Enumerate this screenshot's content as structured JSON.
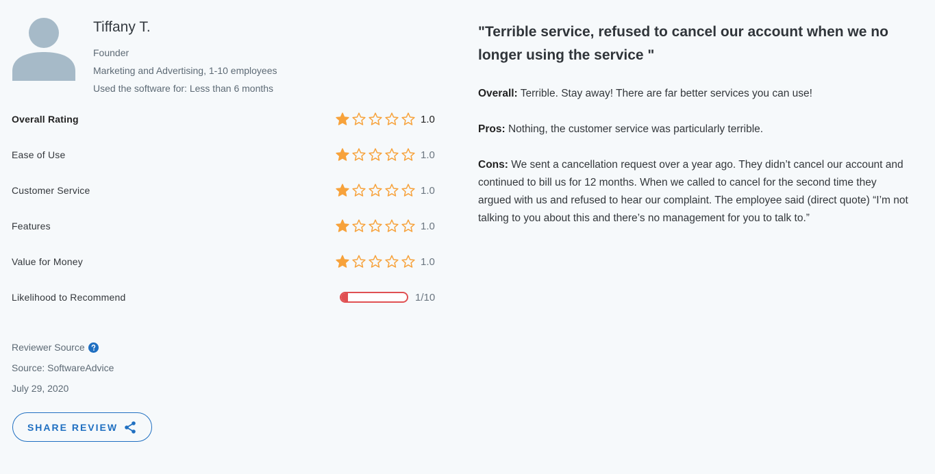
{
  "reviewer": {
    "name": "Tiffany T.",
    "role": "Founder",
    "company": "Marketing and Advertising, 1-10 employees",
    "usage": "Used the software for: Less than 6 months"
  },
  "ratings": [
    {
      "label": "Overall Rating",
      "value": "1.0",
      "stars": 1
    },
    {
      "label": "Ease of Use",
      "value": "1.0",
      "stars": 1
    },
    {
      "label": "Customer Service",
      "value": "1.0",
      "stars": 1
    },
    {
      "label": "Features",
      "value": "1.0",
      "stars": 1
    },
    {
      "label": "Value for Money",
      "value": "1.0",
      "stars": 1
    }
  ],
  "recommend": {
    "label": "Likelihood to Recommend",
    "value": "1/10",
    "fraction": 0.1
  },
  "source": {
    "reviewer_source_label": "Reviewer Source",
    "source_text": "Source: SoftwareAdvice",
    "date": "July 29, 2020"
  },
  "share_button": "SHARE REVIEW",
  "review": {
    "title": "\"Terrible service, refused to cancel our account when we no longer using the service \"",
    "overall_label": "Overall:",
    "overall_text": "Terrible. Stay away! There are far better services you can use!",
    "pros_label": "Pros:",
    "pros_text": "Nothing, the customer service was particularly terrible.",
    "cons_label": "Cons:",
    "cons_text": "We sent a cancellation request over a year ago. They didn’t cancel our account and continued to bill us for 12 months. When we called to cancel for the second time they argued with us and refused to hear our complaint. The employee said (direct quote) “I’m not talking to you about this and there’s no management for you to talk to.”"
  },
  "colors": {
    "star": "#f7a23b",
    "accent": "#1f6fc1",
    "bar": "#e05052",
    "avatar": "#a6bac8"
  }
}
